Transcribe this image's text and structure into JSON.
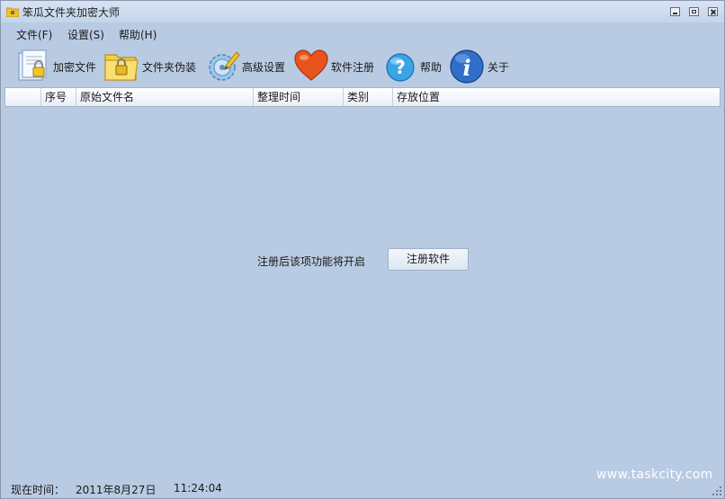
{
  "window": {
    "title": "笨瓜文件夹加密大师"
  },
  "menu": [
    {
      "label": "文件(F)"
    },
    {
      "label": "设置(S)"
    },
    {
      "label": "帮助(H)"
    }
  ],
  "toolbar": [
    {
      "label": "加密文件",
      "icon": "encrypt-file-icon"
    },
    {
      "label": "文件夹伪装",
      "icon": "folder-lock-icon"
    },
    {
      "label": "高级设置",
      "icon": "settings-gear-icon"
    },
    {
      "label": "软件注册",
      "icon": "heart-icon"
    },
    {
      "label": "帮助",
      "icon": "help-icon"
    },
    {
      "label": "关于",
      "icon": "info-icon"
    }
  ],
  "table": {
    "columns": [
      "",
      "序号",
      "原始文件名",
      "整理时间",
      "类别",
      "存放位置"
    ]
  },
  "notice": {
    "text": "注册后该项功能将开启",
    "button": "注册软件"
  },
  "status": {
    "label": "现在时间：",
    "date": "2011年8月27日",
    "time": "11:24:04"
  },
  "watermark": "www.taskcity.com"
}
